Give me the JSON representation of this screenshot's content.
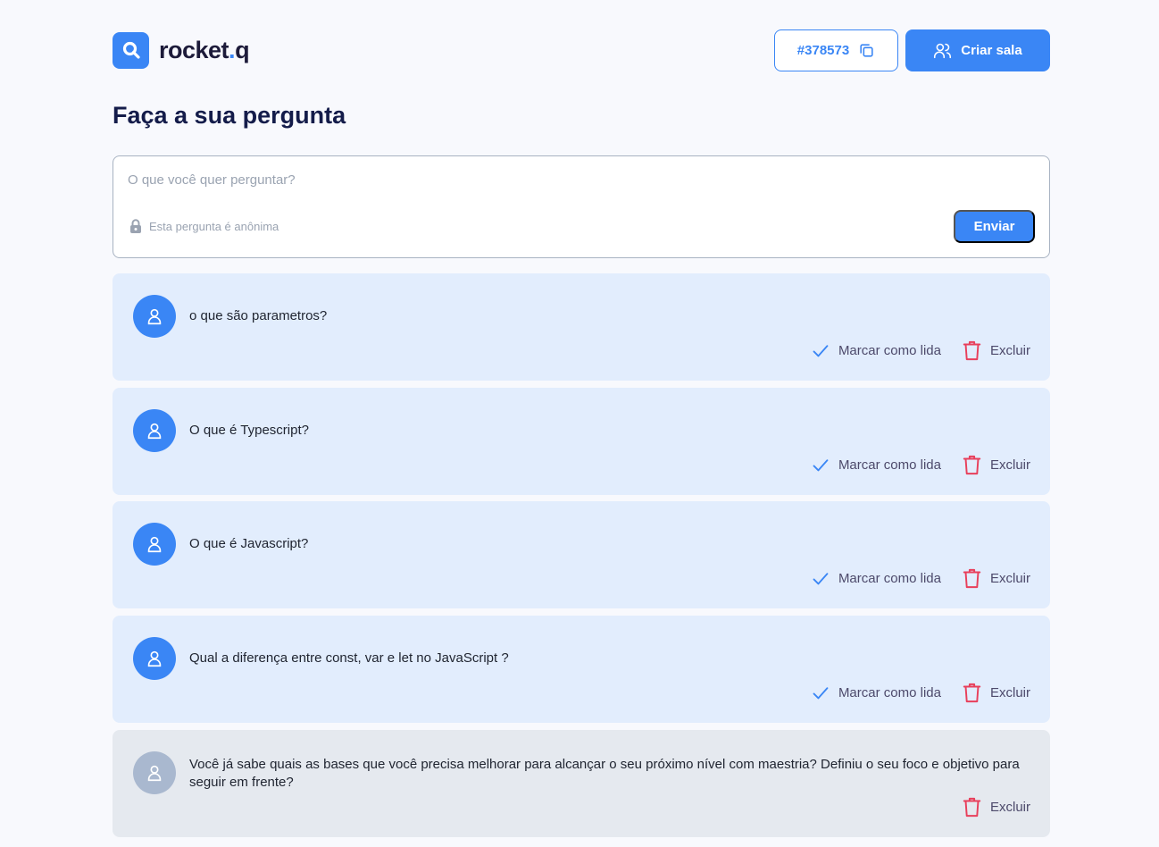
{
  "header": {
    "logo_text": "rocket",
    "logo_dot": ".",
    "logo_suffix": "q",
    "room_code": "#378573",
    "create_room_label": "Criar sala"
  },
  "main": {
    "title": "Faça a sua pergunta",
    "ask": {
      "placeholder": "O que você quer perguntar?",
      "anonymous_note": "Esta pergunta é anônima",
      "send_label": "Enviar"
    }
  },
  "questions": [
    {
      "text": "o que são parametros?",
      "mark_read_label": "Marcar como lida",
      "delete_label": "Excluir"
    },
    {
      "text": "O que é Typescript?",
      "mark_read_label": "Marcar como lida",
      "delete_label": "Excluir"
    },
    {
      "text": "O que é Javascript?",
      "mark_read_label": "Marcar como lida",
      "delete_label": "Excluir"
    },
    {
      "text": "Qual a diferença entre const, var e let no JavaScript ?",
      "mark_read_label": "Marcar como lida",
      "delete_label": "Excluir"
    },
    {
      "text": "Você já sabe quais as bases que você precisa melhorar para alcançar o seu próximo nível com maestria? Definiu o seu foco e objetivo para seguir em frente?",
      "delete_label": "Excluir"
    }
  ],
  "colors": {
    "accent": "#3a86f5",
    "danger": "#e83f5b",
    "question_bg": "#e2edfd",
    "read_question_bg": "#e5e9ef"
  }
}
